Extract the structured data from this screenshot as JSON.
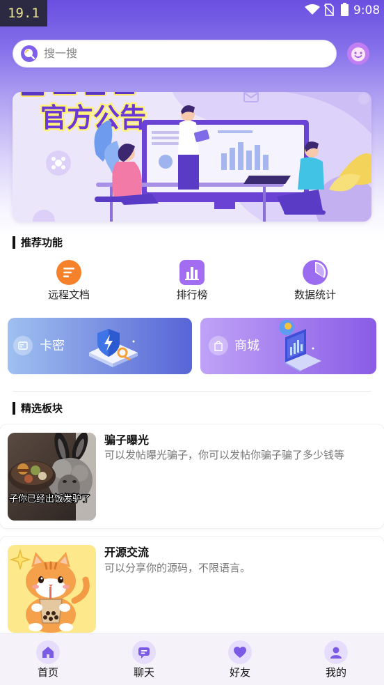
{
  "status_bar": {
    "fps_counter": "19.1",
    "time": "9:08",
    "icons": [
      "wifi-icon",
      "no-sim-icon",
      "battery-icon"
    ]
  },
  "header": {
    "search_icon": "search-icon",
    "search_placeholder": "搜一搜",
    "avatar_icon": "avatar-icon"
  },
  "banner": {
    "title": "官方公告"
  },
  "recommend": {
    "heading": "推荐功能",
    "items": [
      {
        "label": "远程文档",
        "icon": "document-icon",
        "color": "#f5822b"
      },
      {
        "label": "排行榜",
        "icon": "ranking-icon",
        "color": "#a26df1"
      },
      {
        "label": "数据统计",
        "icon": "pie-chart-icon",
        "color": "#9c6cf0"
      }
    ]
  },
  "quick_cards": [
    {
      "label": "卡密",
      "icon": "card-icon",
      "gradient": [
        "#9fc0f0",
        "#5865d6"
      ]
    },
    {
      "label": "商城",
      "icon": "shopping-bag-icon",
      "gradient": [
        "#bfa2f7",
        "#8a5ce6"
      ]
    }
  ],
  "featured": {
    "heading": "精选板块",
    "items": [
      {
        "title": "骗子曝光",
        "description": "可以发帖曝光骗子，你可以发帖你骗子骗了多少钱等",
        "image_caption": "子你已经出饭发驴了"
      },
      {
        "title": "开源交流",
        "description": "可以分享你的源码，不限语言。"
      }
    ]
  },
  "tabbar": {
    "items": [
      {
        "label": "首页",
        "icon": "home-icon"
      },
      {
        "label": "聊天",
        "icon": "chat-icon"
      },
      {
        "label": "好友",
        "icon": "heart-icon"
      },
      {
        "label": "我的",
        "icon": "user-icon"
      }
    ]
  },
  "colors": {
    "accent": "#7b5ae6",
    "header_top": "#6a4fe0",
    "tab_icon_bg": "#e6ddfc",
    "tabbar_bg": "#f5f3f9"
  }
}
